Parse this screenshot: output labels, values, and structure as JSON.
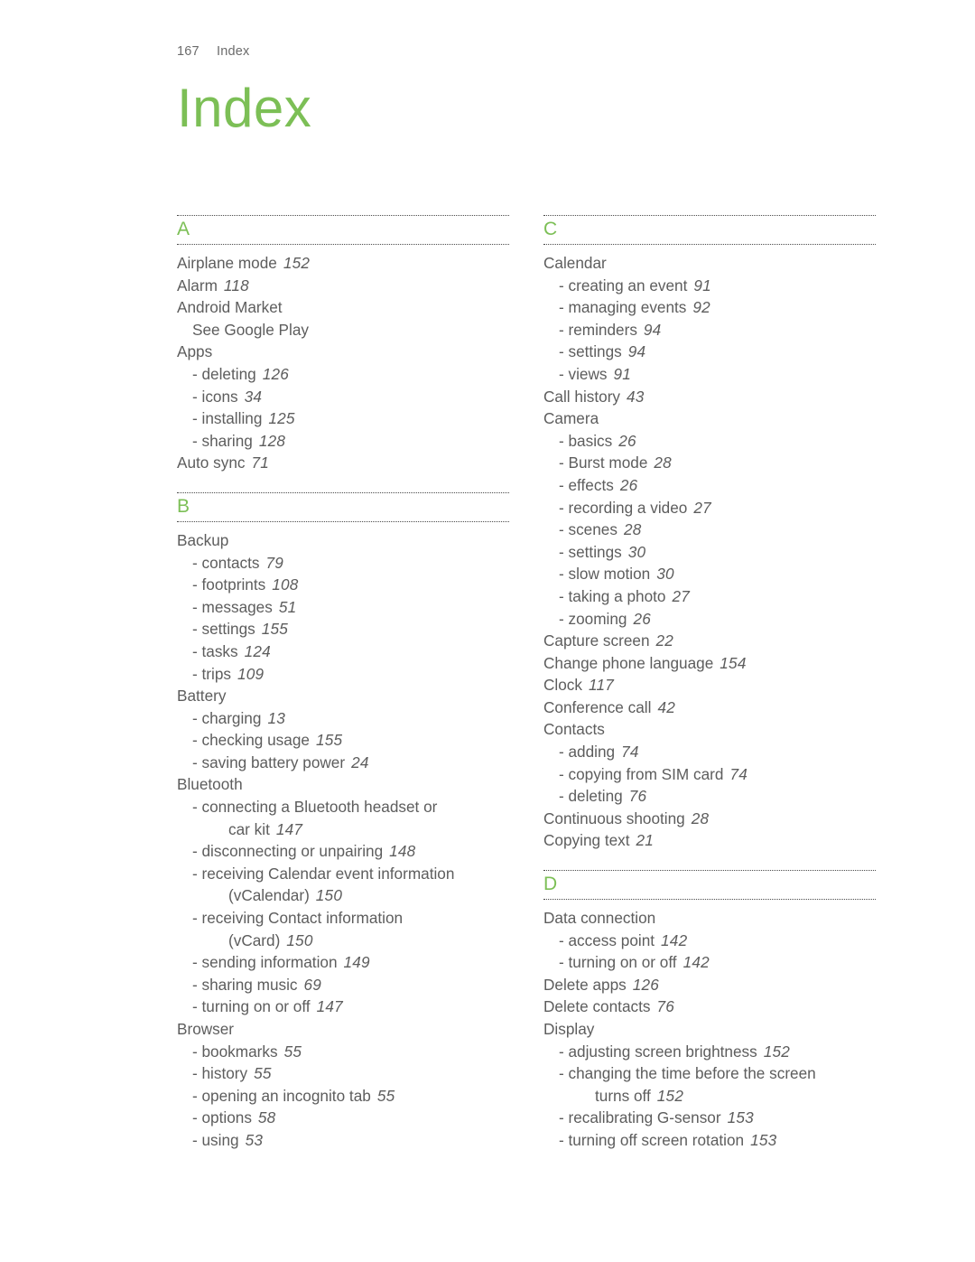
{
  "running_head": {
    "folio": "167",
    "label": "Index"
  },
  "title": "Index",
  "colors": {
    "accent_green": "#7CBF56",
    "body_text": "#5d5d5d",
    "rule": "#4b4b4b"
  },
  "columns": [
    {
      "sections": [
        {
          "letter": "A",
          "entries": [
            {
              "kind": "main",
              "text": "Airplane mode",
              "page": "152"
            },
            {
              "kind": "main",
              "text": "Alarm",
              "page": "118"
            },
            {
              "kind": "main",
              "text": "Android Market",
              "page": ""
            },
            {
              "kind": "xref",
              "text": "See Google Play",
              "page": ""
            },
            {
              "kind": "main",
              "text": "Apps",
              "page": ""
            },
            {
              "kind": "sub",
              "text": "- deleting",
              "page": "126"
            },
            {
              "kind": "sub",
              "text": "- icons",
              "page": "34"
            },
            {
              "kind": "sub",
              "text": "- installing",
              "page": "125"
            },
            {
              "kind": "sub",
              "text": "- sharing",
              "page": "128"
            },
            {
              "kind": "main",
              "text": "Auto sync",
              "page": "71"
            }
          ]
        },
        {
          "letter": "B",
          "entries": [
            {
              "kind": "main",
              "text": "Backup",
              "page": ""
            },
            {
              "kind": "sub",
              "text": "- contacts",
              "page": "79"
            },
            {
              "kind": "sub",
              "text": "- footprints",
              "page": "108"
            },
            {
              "kind": "sub",
              "text": "- messages",
              "page": "51"
            },
            {
              "kind": "sub",
              "text": "- settings",
              "page": "155"
            },
            {
              "kind": "sub",
              "text": "- tasks",
              "page": "124"
            },
            {
              "kind": "sub",
              "text": "- trips",
              "page": "109"
            },
            {
              "kind": "main",
              "text": "Battery",
              "page": ""
            },
            {
              "kind": "sub",
              "text": "- charging",
              "page": "13"
            },
            {
              "kind": "sub",
              "text": "- checking usage",
              "page": "155"
            },
            {
              "kind": "sub",
              "text": "- saving battery power",
              "page": "24"
            },
            {
              "kind": "main",
              "text": "Bluetooth",
              "page": ""
            },
            {
              "kind": "sub",
              "text": "- connecting a Bluetooth headset or",
              "page": ""
            },
            {
              "kind": "cont",
              "text": "car kit",
              "page": "147"
            },
            {
              "kind": "sub",
              "text": "- disconnecting or unpairing",
              "page": "148"
            },
            {
              "kind": "sub",
              "text": "- receiving Calendar event information",
              "page": ""
            },
            {
              "kind": "cont",
              "text": "(vCalendar)",
              "page": "150"
            },
            {
              "kind": "sub",
              "text": "- receiving Contact information",
              "page": ""
            },
            {
              "kind": "cont",
              "text": "(vCard)",
              "page": "150"
            },
            {
              "kind": "sub",
              "text": "- sending information",
              "page": "149"
            },
            {
              "kind": "sub",
              "text": "- sharing music",
              "page": "69"
            },
            {
              "kind": "sub",
              "text": "- turning on or off",
              "page": "147"
            },
            {
              "kind": "main",
              "text": "Browser",
              "page": ""
            },
            {
              "kind": "sub",
              "text": "- bookmarks",
              "page": "55"
            },
            {
              "kind": "sub",
              "text": "- history",
              "page": "55"
            },
            {
              "kind": "sub",
              "text": "- opening an incognito tab",
              "page": "55"
            },
            {
              "kind": "sub",
              "text": "- options",
              "page": "58"
            },
            {
              "kind": "sub",
              "text": "- using",
              "page": "53"
            }
          ]
        }
      ]
    },
    {
      "sections": [
        {
          "letter": "C",
          "entries": [
            {
              "kind": "main",
              "text": "Calendar",
              "page": ""
            },
            {
              "kind": "sub",
              "text": "- creating an event",
              "page": "91"
            },
            {
              "kind": "sub",
              "text": "- managing events",
              "page": "92"
            },
            {
              "kind": "sub",
              "text": "- reminders",
              "page": "94"
            },
            {
              "kind": "sub",
              "text": "- settings",
              "page": "94"
            },
            {
              "kind": "sub",
              "text": "- views",
              "page": "91"
            },
            {
              "kind": "main",
              "text": "Call history",
              "page": "43"
            },
            {
              "kind": "main",
              "text": "Camera",
              "page": ""
            },
            {
              "kind": "sub",
              "text": "- basics",
              "page": "26"
            },
            {
              "kind": "sub",
              "text": "- Burst mode",
              "page": "28"
            },
            {
              "kind": "sub",
              "text": "- effects",
              "page": "26"
            },
            {
              "kind": "sub",
              "text": "- recording a video",
              "page": "27"
            },
            {
              "kind": "sub",
              "text": "- scenes",
              "page": "28"
            },
            {
              "kind": "sub",
              "text": "- settings",
              "page": "30"
            },
            {
              "kind": "sub",
              "text": "- slow motion",
              "page": "30"
            },
            {
              "kind": "sub",
              "text": "- taking a photo",
              "page": "27"
            },
            {
              "kind": "sub",
              "text": "- zooming",
              "page": "26"
            },
            {
              "kind": "main",
              "text": "Capture screen",
              "page": "22"
            },
            {
              "kind": "main",
              "text": "Change phone language",
              "page": "154"
            },
            {
              "kind": "main",
              "text": "Clock",
              "page": "117"
            },
            {
              "kind": "main",
              "text": "Conference call",
              "page": "42"
            },
            {
              "kind": "main",
              "text": "Contacts",
              "page": ""
            },
            {
              "kind": "sub",
              "text": "- adding",
              "page": "74"
            },
            {
              "kind": "sub",
              "text": "- copying from SIM card",
              "page": "74"
            },
            {
              "kind": "sub",
              "text": "- deleting",
              "page": "76"
            },
            {
              "kind": "main",
              "text": "Continuous shooting",
              "page": "28"
            },
            {
              "kind": "main",
              "text": "Copying text",
              "page": "21"
            }
          ]
        },
        {
          "letter": "D",
          "entries": [
            {
              "kind": "main",
              "text": "Data connection",
              "page": ""
            },
            {
              "kind": "sub",
              "text": "- access point",
              "page": "142"
            },
            {
              "kind": "sub",
              "text": "- turning on or off",
              "page": "142"
            },
            {
              "kind": "main",
              "text": "Delete apps",
              "page": "126"
            },
            {
              "kind": "main",
              "text": "Delete contacts",
              "page": "76"
            },
            {
              "kind": "main",
              "text": "Display",
              "page": ""
            },
            {
              "kind": "sub",
              "text": "- adjusting screen brightness",
              "page": "152"
            },
            {
              "kind": "sub",
              "text": "- changing the time before the screen",
              "page": ""
            },
            {
              "kind": "cont",
              "text": "turns off",
              "page": "152"
            },
            {
              "kind": "sub",
              "text": "- recalibrating G-sensor",
              "page": "153"
            },
            {
              "kind": "sub",
              "text": "- turning off screen rotation",
              "page": "153"
            }
          ]
        }
      ]
    }
  ]
}
